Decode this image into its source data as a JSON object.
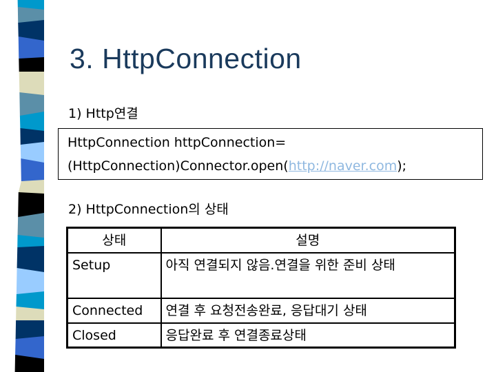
{
  "decoration": {
    "stripe_colors": [
      "#0099cc",
      "#5b8fa8",
      "#003366",
      "#3366cc",
      "#000000",
      "#dddcba",
      "#5b8fa8",
      "#0099cc",
      "#003366",
      "#99ccff",
      "#3366cc",
      "#dddcba",
      "#000000",
      "#5b8fa8",
      "#0099cc",
      "#003366",
      "#99ccff",
      "#0099cc",
      "#dddcba",
      "#003366",
      "#3366cc",
      "#000000"
    ]
  },
  "slide": {
    "title": "3. HttpConnection",
    "section1": {
      "label": "1) Http연결",
      "code_line1": "HttpConnection httpConnection=",
      "code_line2_prefix": "(HttpConnection)Connector.open(",
      "code_link": "http://naver.com",
      "code_line2_suffix": ");"
    },
    "section2": {
      "label": "2) HttpConnection의 상태",
      "table": {
        "headers": [
          "상태",
          "설명"
        ],
        "rows": [
          {
            "state": "Setup",
            "description": "아직 연결되지 않음.연결을 위한 준비 상태"
          },
          {
            "state": "Connected",
            "description": "연결 후 요청전송완료, 응답대기 상태"
          },
          {
            "state": "Closed",
            "description": "응답완료 후 연결종료상태"
          }
        ]
      }
    }
  }
}
